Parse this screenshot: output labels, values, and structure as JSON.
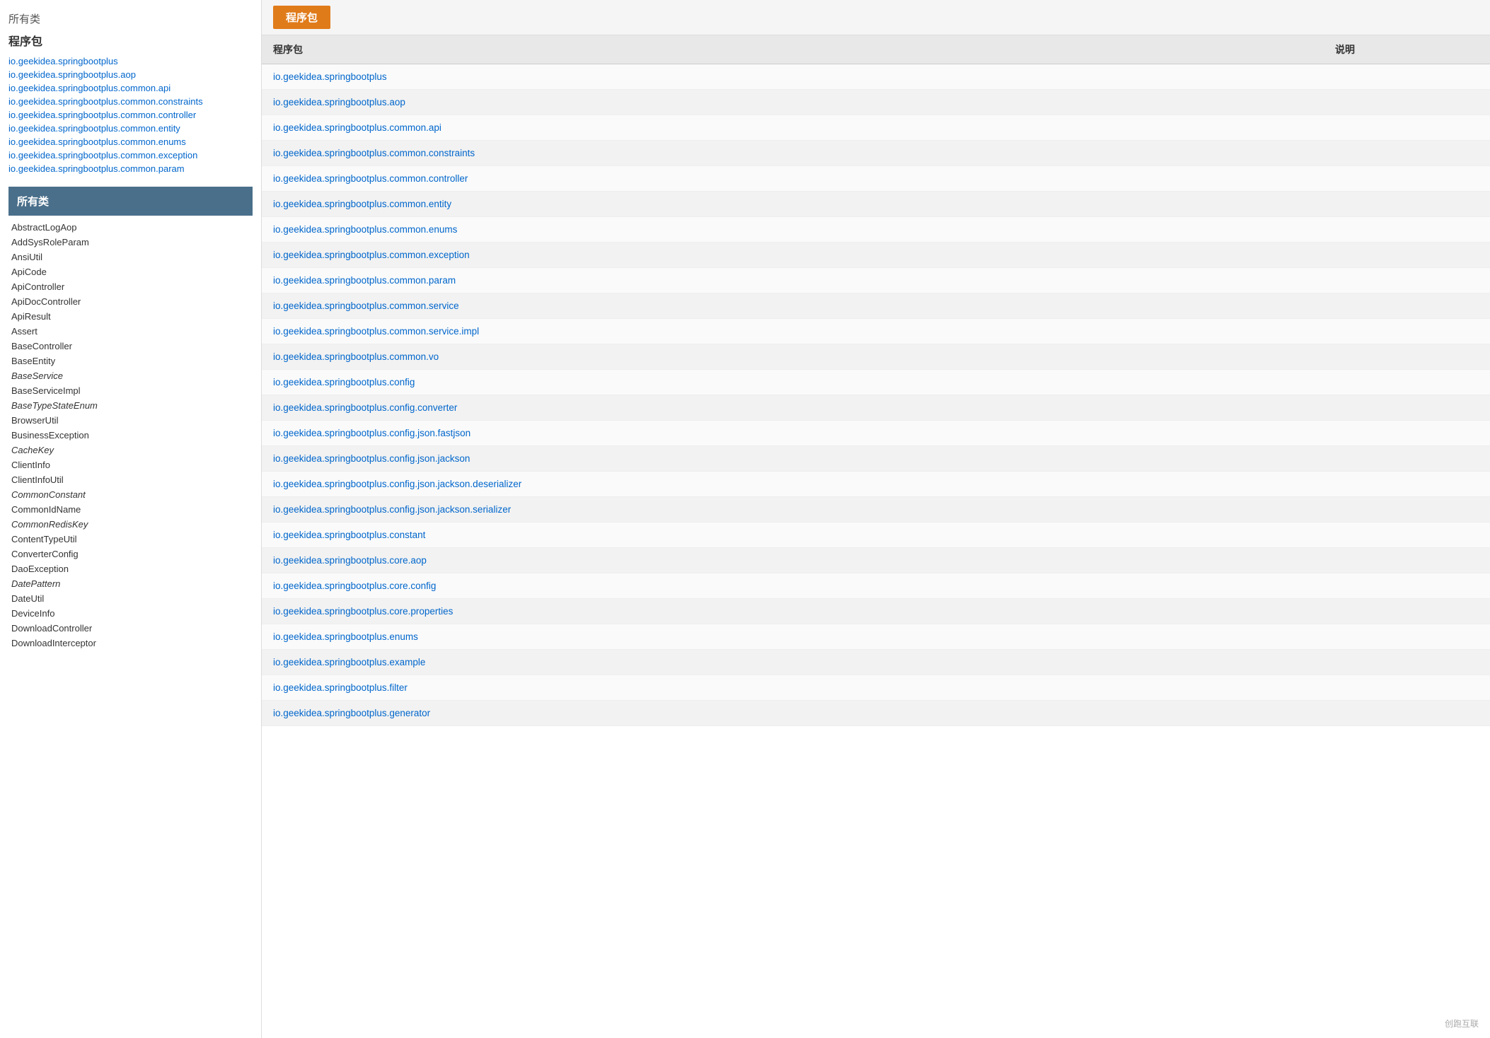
{
  "sidebar": {
    "section_title": "所有类",
    "pkg_title": "程序包",
    "packages": [
      "io.geekidea.springbootplus",
      "io.geekidea.springbootplus.aop",
      "io.geekidea.springbootplus.common.api",
      "io.geekidea.springbootplus.common.constraints",
      "io.geekidea.springbootplus.common.controller",
      "io.geekidea.springbootplus.common.entity",
      "io.geekidea.springbootplus.common.enums",
      "io.geekidea.springbootplus.common.exception",
      "io.geekidea.springbootplus.common.param"
    ],
    "class_header": "所有类",
    "classes": [
      {
        "name": "AbstractLogAop",
        "italic": false
      },
      {
        "name": "AddSysRoleParam",
        "italic": false
      },
      {
        "name": "AnsiUtil",
        "italic": false
      },
      {
        "name": "ApiCode",
        "italic": false
      },
      {
        "name": "ApiController",
        "italic": false
      },
      {
        "name": "ApiDocController",
        "italic": false
      },
      {
        "name": "ApiResult",
        "italic": false
      },
      {
        "name": "Assert",
        "italic": false
      },
      {
        "name": "BaseController",
        "italic": false
      },
      {
        "name": "BaseEntity",
        "italic": false
      },
      {
        "name": "BaseService",
        "italic": true
      },
      {
        "name": "BaseServiceImpl",
        "italic": false
      },
      {
        "name": "BaseTypeStateEnum",
        "italic": true
      },
      {
        "name": "BrowserUtil",
        "italic": false
      },
      {
        "name": "BusinessException",
        "italic": false
      },
      {
        "name": "CacheKey",
        "italic": true
      },
      {
        "name": "ClientInfo",
        "italic": false
      },
      {
        "name": "ClientInfoUtil",
        "italic": false
      },
      {
        "name": "CommonConstant",
        "italic": true
      },
      {
        "name": "CommonIdName",
        "italic": false
      },
      {
        "name": "CommonRedisKey",
        "italic": true
      },
      {
        "name": "ContentTypeUtil",
        "italic": false
      },
      {
        "name": "ConverterConfig",
        "italic": false
      },
      {
        "name": "DaoException",
        "italic": false
      },
      {
        "name": "DatePattern",
        "italic": true
      },
      {
        "name": "DateUtil",
        "italic": false
      },
      {
        "name": "DeviceInfo",
        "italic": false
      },
      {
        "name": "DownloadController",
        "italic": false
      },
      {
        "name": "DownloadInterceptor",
        "italic": false
      }
    ]
  },
  "main": {
    "tab_label": "程序包",
    "table_headers": [
      "程序包",
      "说明"
    ],
    "rows": [
      {
        "pkg": "io.geekidea.springbootplus",
        "desc": ""
      },
      {
        "pkg": "io.geekidea.springbootplus.aop",
        "desc": ""
      },
      {
        "pkg": "io.geekidea.springbootplus.common.api",
        "desc": ""
      },
      {
        "pkg": "io.geekidea.springbootplus.common.constraints",
        "desc": ""
      },
      {
        "pkg": "io.geekidea.springbootplus.common.controller",
        "desc": ""
      },
      {
        "pkg": "io.geekidea.springbootplus.common.entity",
        "desc": ""
      },
      {
        "pkg": "io.geekidea.springbootplus.common.enums",
        "desc": ""
      },
      {
        "pkg": "io.geekidea.springbootplus.common.exception",
        "desc": ""
      },
      {
        "pkg": "io.geekidea.springbootplus.common.param",
        "desc": ""
      },
      {
        "pkg": "io.geekidea.springbootplus.common.service",
        "desc": ""
      },
      {
        "pkg": "io.geekidea.springbootplus.common.service.impl",
        "desc": ""
      },
      {
        "pkg": "io.geekidea.springbootplus.common.vo",
        "desc": ""
      },
      {
        "pkg": "io.geekidea.springbootplus.config",
        "desc": ""
      },
      {
        "pkg": "io.geekidea.springbootplus.config.converter",
        "desc": ""
      },
      {
        "pkg": "io.geekidea.springbootplus.config.json.fastjson",
        "desc": ""
      },
      {
        "pkg": "io.geekidea.springbootplus.config.json.jackson",
        "desc": ""
      },
      {
        "pkg": "io.geekidea.springbootplus.config.json.jackson.deserializer",
        "desc": ""
      },
      {
        "pkg": "io.geekidea.springbootplus.config.json.jackson.serializer",
        "desc": ""
      },
      {
        "pkg": "io.geekidea.springbootplus.constant",
        "desc": ""
      },
      {
        "pkg": "io.geekidea.springbootplus.core.aop",
        "desc": ""
      },
      {
        "pkg": "io.geekidea.springbootplus.core.config",
        "desc": ""
      },
      {
        "pkg": "io.geekidea.springbootplus.core.properties",
        "desc": ""
      },
      {
        "pkg": "io.geekidea.springbootplus.enums",
        "desc": ""
      },
      {
        "pkg": "io.geekidea.springbootplus.example",
        "desc": ""
      },
      {
        "pkg": "io.geekidea.springbootplus.filter",
        "desc": ""
      },
      {
        "pkg": "io.geekidea.springbootplus.generator",
        "desc": ""
      }
    ]
  },
  "watermark": "创跑互联"
}
